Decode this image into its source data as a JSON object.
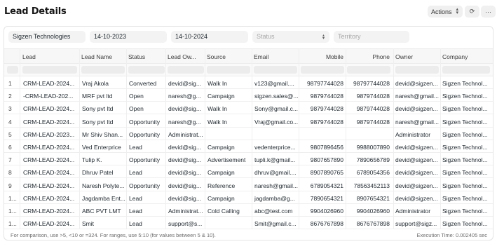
{
  "page": {
    "title": "Lead Details"
  },
  "toolbar": {
    "actions_label": "Actions",
    "refresh_icon": "refresh-icon",
    "more_icon": "more-icon"
  },
  "filters": {
    "company": "Sigzen Technologies",
    "from_date": "14-10-2023",
    "to_date": "14-10-2024",
    "status_placeholder": "Status",
    "territory_placeholder": "Territory"
  },
  "columns": [
    "Lead",
    "Lead Name",
    "Status",
    "Lead Ow...",
    "Source",
    "Email",
    "Mobile",
    "Phone",
    "Owner",
    "Company"
  ],
  "rows": [
    {
      "n": "1",
      "lead": "CRM-LEAD-2024...",
      "name": "Vraj Akola",
      "status": "Converted",
      "owner_short": "devid@sig...",
      "source": "Walk In",
      "email": "v123@gmail....",
      "mobile": "98797744028",
      "phone": "98797744028",
      "owner": "devid@sigzen...",
      "company": "Sigzen Technol..."
    },
    {
      "n": "2",
      "lead": "-CRM-LEAD-202...",
      "name": "MRF pvt ltd",
      "status": "Open",
      "owner_short": "naresh@g...",
      "source": "Campaign",
      "email": "sigzen.sales@...",
      "mobile": "9879744028",
      "phone": "9879744028",
      "owner": "naresh@gmail...",
      "company": "Sigzen Technol..."
    },
    {
      "n": "3",
      "lead": "CRM-LEAD-2024...",
      "name": "Sony pvt ltd",
      "status": "Open",
      "owner_short": "devid@sig...",
      "source": "Walk In",
      "email": "Sony@gmail.c...",
      "mobile": "9879744028",
      "phone": "9879744028",
      "owner": "devid@sigzen...",
      "company": "Sigzen Technol..."
    },
    {
      "n": "4",
      "lead": "CRM-LEAD-2024...",
      "name": "Sony pvt ltd",
      "status": "Opportunity",
      "owner_short": "naresh@g...",
      "source": "Walk In",
      "email": "Vraj@gmail.co...",
      "mobile": "9879744028",
      "phone": "9879744028",
      "owner": "naresh@gmail...",
      "company": "Sigzen Technol..."
    },
    {
      "n": "5",
      "lead": "CRM-LEAD-2023...",
      "name": "Mr Shiv Shan...",
      "status": "Opportunity",
      "owner_short": "Administrat...",
      "source": "",
      "email": "",
      "mobile": "",
      "phone": "",
      "owner": "Administrator",
      "company": "Sigzen Technol..."
    },
    {
      "n": "6",
      "lead": "CRM-LEAD-2024...",
      "name": "Ved Enterprice",
      "status": "Lead",
      "owner_short": "devid@sig...",
      "source": "Campaign",
      "email": "vedenterprice...",
      "mobile": "9807896456",
      "phone": "9988007890",
      "owner": "devid@sigzen...",
      "company": "Sigzen Technol..."
    },
    {
      "n": "7",
      "lead": "CRM-LEAD-2024...",
      "name": "Tulip K.",
      "status": "Opportunity",
      "owner_short": "devid@sig...",
      "source": "Advertisement",
      "email": "tupli.k@gmail...",
      "mobile": "9807657890",
      "phone": "7890656789",
      "owner": "devid@sigzen...",
      "company": "Sigzen Technol..."
    },
    {
      "n": "8",
      "lead": "CRM-LEAD-2024...",
      "name": "Dhruv Patel",
      "status": "Lead",
      "owner_short": "devid@sig...",
      "source": "Campaign",
      "email": "dhruv@gmail....",
      "mobile": "8907890765",
      "phone": "6789054356",
      "owner": "devid@sigzen...",
      "company": "Sigzen Technol..."
    },
    {
      "n": "9",
      "lead": "CRM-LEAD-2024...",
      "name": "Naresh Polyte...",
      "status": "Opportunity",
      "owner_short": "devid@sig...",
      "source": "Reference",
      "email": "naresh@gmail...",
      "mobile": "6789054321",
      "phone": "78563452113",
      "owner": "devid@sigzen...",
      "company": "Sigzen Technol..."
    },
    {
      "n": "1...",
      "lead": "CRM-LEAD-2024...",
      "name": "Jagdamba Ent...",
      "status": "Lead",
      "owner_short": "devid@sig...",
      "source": "Campaign",
      "email": "jagdamba@g...",
      "mobile": "7890654321",
      "phone": "8907654321",
      "owner": "devid@sigzen...",
      "company": "Sigzen Technol..."
    },
    {
      "n": "1...",
      "lead": "CRM-LEAD-2024...",
      "name": "ABC PVT LMT",
      "status": "Lead",
      "owner_short": "Administrat...",
      "source": "Cold Calling",
      "email": "abc@test.com",
      "mobile": "9904026960",
      "phone": "9904026960",
      "owner": "Administrator",
      "company": "Sigzen Technol..."
    },
    {
      "n": "1...",
      "lead": "CRM-LEAD-2024...",
      "name": "Smit",
      "status": "Lead",
      "owner_short": "support@s...",
      "source": "",
      "email": "Smit@gmail.c...",
      "mobile": "8676767898",
      "phone": "8676767898",
      "owner": "support@sigz...",
      "company": "Sigzen Technol..."
    }
  ],
  "footer": {
    "hint": "For comparison, use >5, <10 or =324. For ranges, use 5:10 (for values between 5 & 10).",
    "execution_time": "Execution Time: 0.002405 sec"
  }
}
